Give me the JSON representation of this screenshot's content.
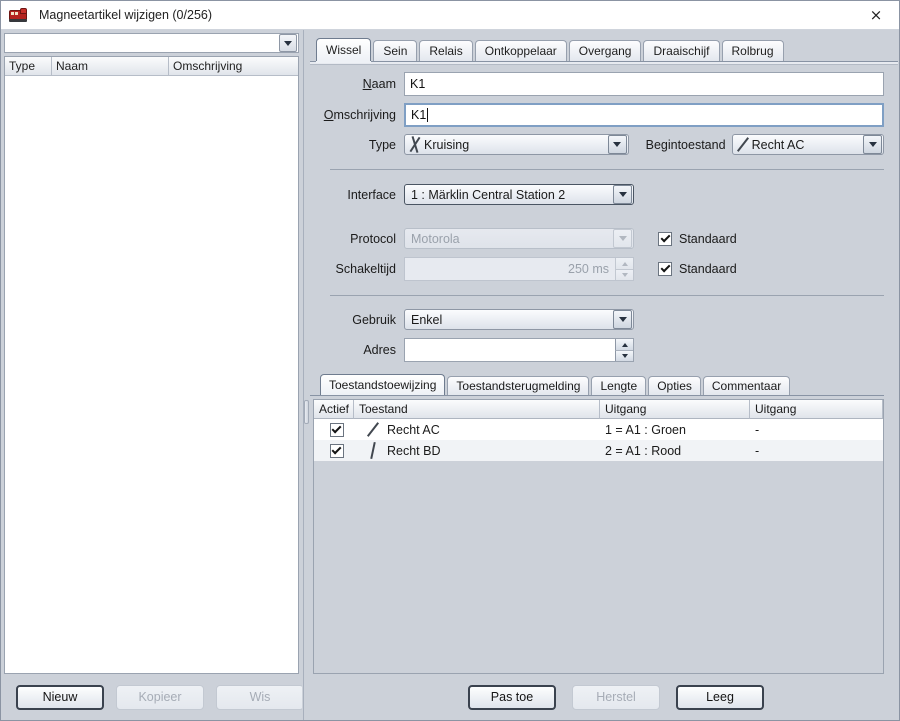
{
  "window": {
    "title": "Magneetartikel wijzigen (0/256)",
    "icon": "locomotive-icon",
    "close_label": "×"
  },
  "left": {
    "filter": {
      "value": "",
      "icon": "chevron-down-icon"
    },
    "list": {
      "columns": [
        "Type",
        "Naam",
        "Omschrijving"
      ],
      "rows": []
    },
    "buttons": [
      {
        "label": "Nieuw",
        "mnemonic": "N",
        "enabled": true,
        "focused": true
      },
      {
        "label": "Kopieer",
        "mnemonic": "o",
        "enabled": false,
        "focused": false
      },
      {
        "label": "Wis",
        "mnemonic": "W",
        "enabled": false,
        "focused": false
      }
    ]
  },
  "tabs": [
    {
      "label": "Wissel",
      "active": true
    },
    {
      "label": "Sein",
      "active": false
    },
    {
      "label": "Relais",
      "active": false
    },
    {
      "label": "Ontkoppelaar",
      "active": false
    },
    {
      "label": "Overgang",
      "active": false
    },
    {
      "label": "Draaischijf",
      "active": false
    },
    {
      "label": "Rolbrug",
      "active": false
    }
  ],
  "form": {
    "naam": {
      "label": "Naam",
      "mnemonic": "N",
      "value": "K1"
    },
    "omschrijving": {
      "label": "Omschrijving",
      "mnemonic": "O",
      "value": "K1",
      "focused": true
    },
    "type": {
      "label": "Type",
      "value": "Kruising",
      "icon": "crossing-track-icon"
    },
    "begintoestand": {
      "label": "Begintoestand",
      "value": "Recht AC",
      "icon": "diagonal-track-icon"
    },
    "interface": {
      "label": "Interface",
      "value": "1 : Märklin Central Station 2"
    },
    "protocol": {
      "label": "Protocol",
      "value": "Motorola",
      "enabled": false,
      "standaard": {
        "label": "Standaard",
        "checked": true
      }
    },
    "schakeltijd": {
      "label": "Schakeltijd",
      "value": "250 ms",
      "enabled": false,
      "standaard": {
        "label": "Standaard",
        "checked": true
      }
    },
    "gebruik": {
      "label": "Gebruik",
      "value": "Enkel"
    },
    "adres": {
      "label": "Adres",
      "value": ""
    }
  },
  "inner_tabs": [
    {
      "label": "Toestandstoewijzing",
      "active": true
    },
    {
      "label": "Toestandsterugmelding",
      "active": false
    },
    {
      "label": "Lengte",
      "active": false
    },
    {
      "label": "Opties",
      "active": false
    },
    {
      "label": "Commentaar",
      "active": false
    }
  ],
  "state_table": {
    "columns": [
      "Actief",
      "Toestand",
      "Uitgang",
      "Uitgang"
    ],
    "rows": [
      {
        "actief": true,
        "icon": "diagonal-track-icon",
        "toestand": "Recht AC",
        "uitgang1": "1 = A1 : Groen",
        "uitgang2": "-"
      },
      {
        "actief": true,
        "icon": "steep-track-icon",
        "toestand": "Recht BD",
        "uitgang1": "2 = A1 : Rood",
        "uitgang2": "-"
      }
    ]
  },
  "right_buttons": [
    {
      "label": "Pas toe",
      "mnemonic": "P",
      "enabled": true,
      "focused": true
    },
    {
      "label": "Herstel",
      "mnemonic": "s",
      "enabled": false,
      "focused": false
    },
    {
      "label": "Leeg",
      "mnemonic": "L",
      "enabled": true,
      "focused": true
    }
  ],
  "colors": {
    "panel": "#ccd1d9",
    "field": "#ffffff",
    "border": "#9aa3b0",
    "focus": "#7f9fc4",
    "disabled_text": "#9aa1ab"
  }
}
